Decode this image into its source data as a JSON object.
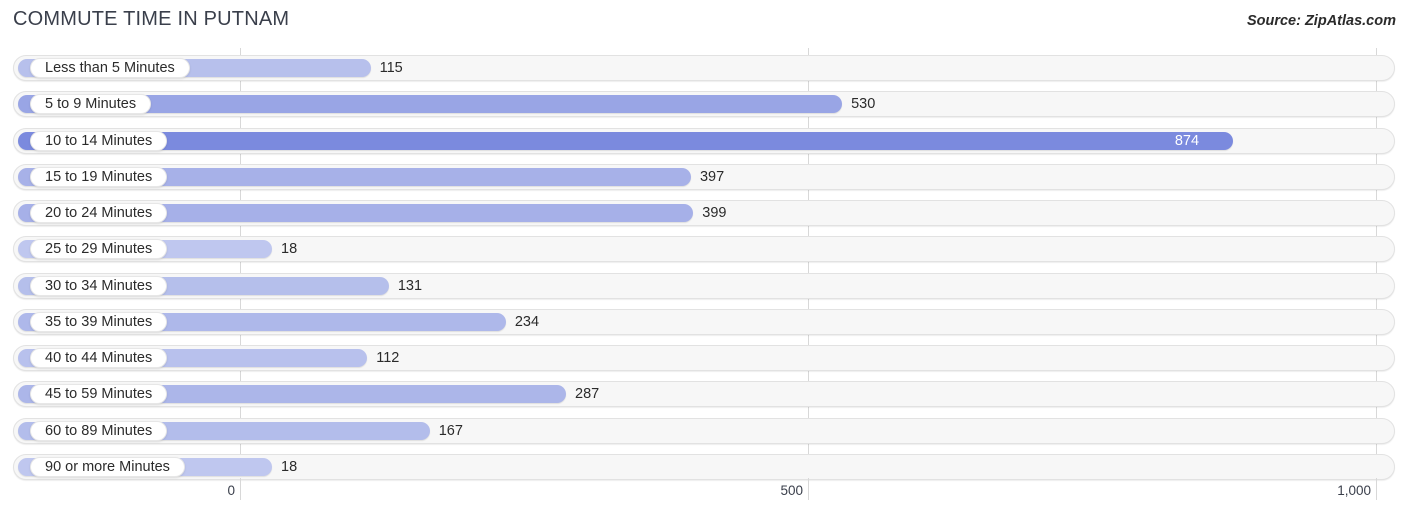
{
  "header": {
    "title": "COMMUTE TIME IN PUTNAM",
    "source": "Source: ZipAtlas.com"
  },
  "chart_data": {
    "type": "bar",
    "orientation": "horizontal",
    "title": "COMMUTE TIME IN PUTNAM",
    "xlabel": "",
    "ylabel": "",
    "xlim": [
      0,
      1000
    ],
    "grid": true,
    "legend": "none",
    "tick_labels": [
      "0",
      "500",
      "1,000"
    ],
    "tick_values": [
      0,
      500,
      1000
    ],
    "categories": [
      "Less than 5 Minutes",
      "5 to 9 Minutes",
      "10 to 14 Minutes",
      "15 to 19 Minutes",
      "20 to 24 Minutes",
      "25 to 29 Minutes",
      "30 to 34 Minutes",
      "35 to 39 Minutes",
      "40 to 44 Minutes",
      "45 to 59 Minutes",
      "60 to 89 Minutes",
      "90 or more Minutes"
    ],
    "values": [
      115,
      530,
      874,
      397,
      399,
      18,
      131,
      234,
      112,
      287,
      167,
      18
    ],
    "value_labels": [
      "115",
      "530",
      "874",
      "397",
      "399",
      "18",
      "131",
      "234",
      "112",
      "287",
      "167",
      "18"
    ],
    "bar_colors": [
      "#b7c0ec",
      "#99a5e5",
      "#7b8ade",
      "#a7b1e8",
      "#a6b0e8",
      "#bfc7ef",
      "#b5bfeb",
      "#aeb8ea",
      "#b8c1ed",
      "#acb6e9",
      "#b3bdeb",
      "#bfc7ef"
    ],
    "label_inside": [
      false,
      false,
      true,
      false,
      false,
      false,
      false,
      false,
      false,
      false,
      false,
      false
    ],
    "track_color": "#f7f7f7",
    "accent_color": "#7b8ade"
  }
}
